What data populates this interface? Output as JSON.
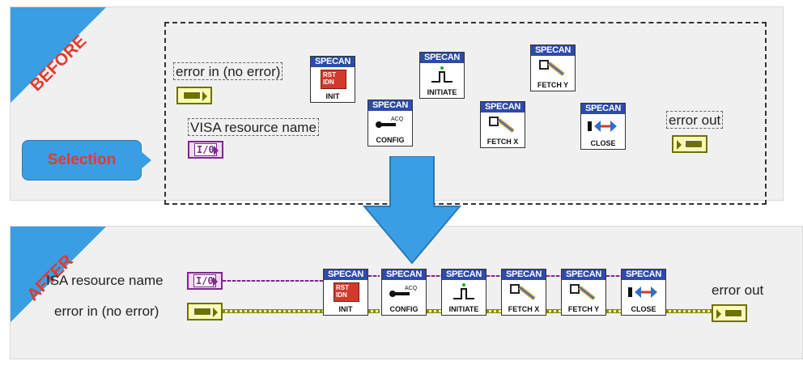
{
  "before": {
    "corner_label": "BEFORE",
    "labels": {
      "error_in": "error in (no error)",
      "visa_resource": "VISA resource name",
      "error_out": "error out"
    },
    "callout": "Selection",
    "io_text": "I/0"
  },
  "after": {
    "corner_label": "AFTER",
    "labels": {
      "visa_resource": "ISA resource name",
      "error_in": "error in (no error)",
      "error_out": "error out"
    },
    "io_text": "I/0"
  },
  "vis": [
    {
      "header": "SPECAN",
      "footer": "INIT",
      "sub": "RST IDN"
    },
    {
      "header": "SPECAN",
      "footer": "CONFIG",
      "sub": "ACQ"
    },
    {
      "header": "SPECAN",
      "footer": "INITIATE",
      "sub": ""
    },
    {
      "header": "SPECAN",
      "footer": "FETCH X",
      "sub": ""
    },
    {
      "header": "SPECAN",
      "footer": "FETCH Y",
      "sub": ""
    },
    {
      "header": "SPECAN",
      "footer": "CLOSE",
      "sub": ""
    }
  ],
  "colors": {
    "accent_blue": "#3a9ee4",
    "label_red": "#e13b2c",
    "error_wire": "#8a8c00",
    "visa_wire": "#7a2a8a",
    "vi_header": "#2d4ba8"
  }
}
